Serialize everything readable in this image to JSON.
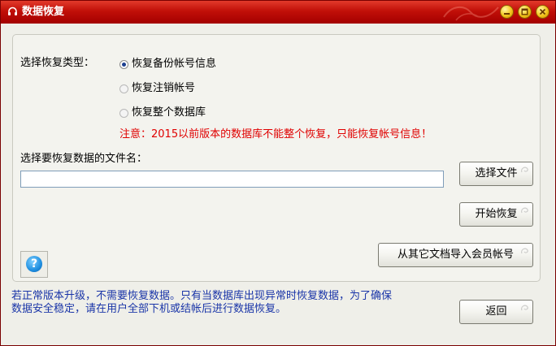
{
  "window": {
    "title": "数据恢复"
  },
  "options": {
    "label": "选择恢复类型：",
    "items": [
      {
        "label": "恢复备份帐号信息",
        "selected": true,
        "enabled": true
      },
      {
        "label": "恢复注销帐号",
        "selected": false,
        "enabled": false
      },
      {
        "label": "恢复整个数据库",
        "selected": false,
        "enabled": false
      }
    ],
    "warning": "注意：2015以前版本的数据库不能整个恢复，只能恢复帐号信息！"
  },
  "file": {
    "label": "选择要恢复数据的文件名：",
    "value": "",
    "select_button": "选择文件"
  },
  "actions": {
    "start_button": "开始恢复",
    "import_button": "从其它文档导入会员帐号",
    "back_button": "返回"
  },
  "footer": {
    "line1": "若正常版本升级，不需要恢复数据。只有当数据库出现异常时恢复数据，为了确保",
    "line2": "数据安全稳定，请在用户全部下机或结帐后进行数据恢复。"
  },
  "help": {
    "glyph": "?"
  },
  "icons": {
    "app": "app-headset-icon",
    "minimize": "minimize-icon",
    "maximize": "maximize-icon",
    "close": "close-icon",
    "help": "help-icon"
  },
  "colors": {
    "titlebar": "#c10f08",
    "warning": "#e00000",
    "info": "#1a35a8"
  }
}
